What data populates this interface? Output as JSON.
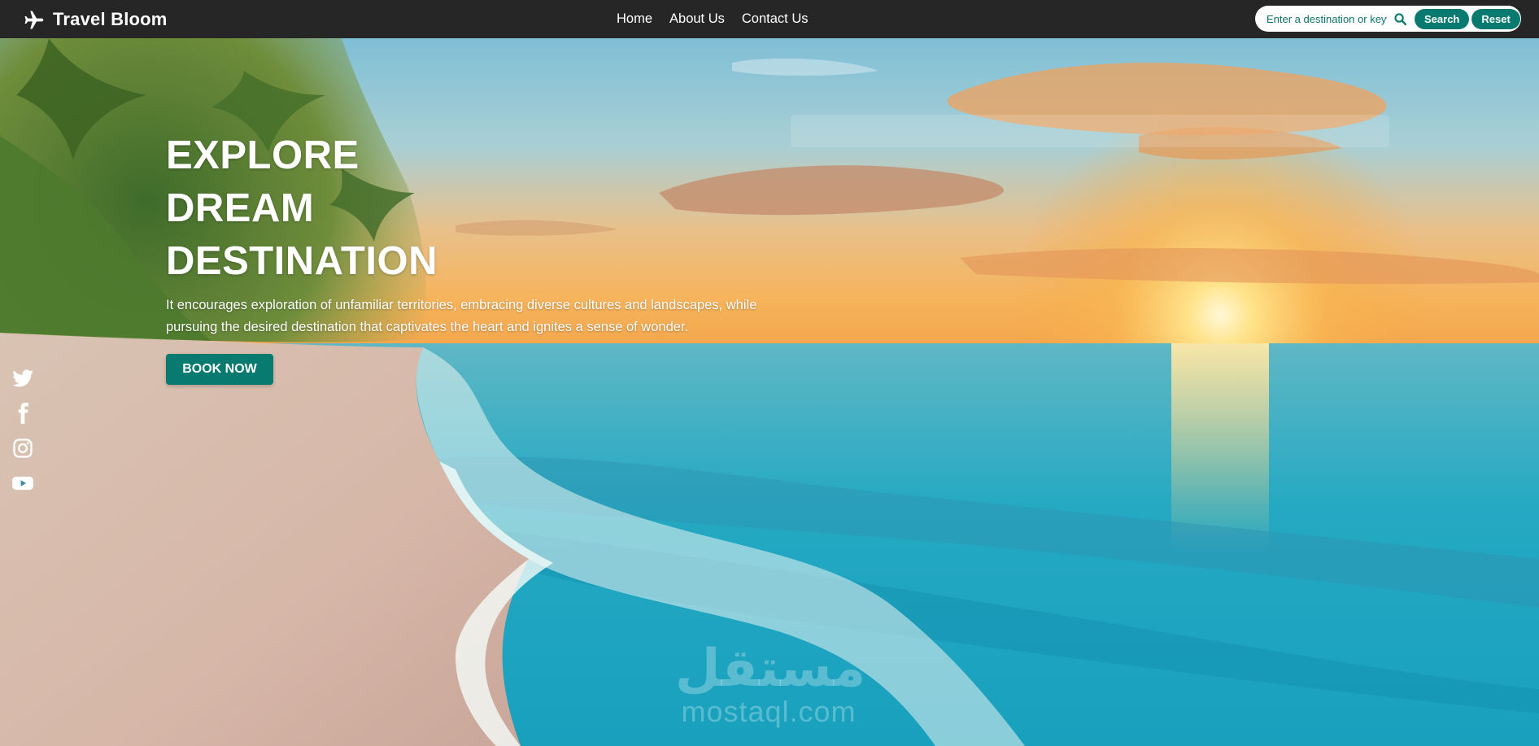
{
  "navbar": {
    "brand": "Travel Bloom",
    "brand_icon": "airplane-icon",
    "links": [
      "Home",
      "About Us",
      "Contact Us"
    ],
    "search": {
      "placeholder": "Enter a destination or keyword",
      "value": "",
      "icon": "search-icon",
      "search_label": "Search",
      "reset_label": "Reset"
    }
  },
  "hero": {
    "title_lines": [
      "EXPLORE",
      "DREAM",
      "DESTINATION"
    ],
    "description": "It encourages exploration of unfamiliar territories, embracing diverse cultures and landscapes, while pursuing the desired destination that captivates the heart and ignites a sense of wonder.",
    "cta_label": "BOOK NOW"
  },
  "social": {
    "icons": [
      "twitter-icon",
      "facebook-icon",
      "instagram-icon",
      "youtube-icon"
    ]
  },
  "watermark": {
    "logo": "مستقل",
    "site": "mostaql.com"
  },
  "colors": {
    "navbar_bg": "#262626",
    "accent": "#087a70",
    "white": "#ffffff"
  }
}
